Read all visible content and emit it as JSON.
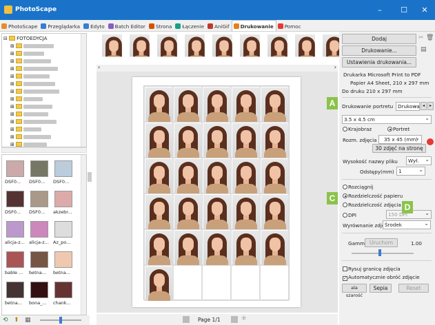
{
  "window": {
    "title": "PhotoScape",
    "minimize": "–",
    "maximize": "☐",
    "close": "✕"
  },
  "tabs": [
    {
      "label": "PhotoScape",
      "color": "#e88b2e"
    },
    {
      "label": "Przeglądarka",
      "color": "#3a7bd5"
    },
    {
      "label": "Edyto",
      "color": "#3a7bd5"
    },
    {
      "label": "Batch Editor",
      "color": "#8a5cc2"
    },
    {
      "label": "Strona",
      "color": "#d35400"
    },
    {
      "label": "Łączenie",
      "color": "#16a085"
    },
    {
      "label": "AniGif",
      "color": "#c0392b"
    },
    {
      "label": "Drukowanie",
      "color": "#e67e22",
      "active": true
    },
    {
      "label": "Pomoc",
      "color": "#e53935"
    }
  ],
  "tree": {
    "root": "FOTOEDYCJA"
  },
  "thumbnails": [
    {
      "label": "DSF0..."
    },
    {
      "label": "DSF0..."
    },
    {
      "label": "DSF0..."
    },
    {
      "label": "DSF0..."
    },
    {
      "label": "DSF0..."
    },
    {
      "label": "akzebr..."
    },
    {
      "label": "alicja-z..."
    },
    {
      "label": "alicja-z..."
    },
    {
      "label": "Az_po..."
    },
    {
      "label": "bable ..."
    },
    {
      "label": "betna..."
    },
    {
      "label": "betna..."
    },
    {
      "label": "betna..."
    },
    {
      "label": "bona_..."
    },
    {
      "label": "chank..."
    }
  ],
  "pager": {
    "text": "Page 1/1"
  },
  "right": {
    "add": "Dodaj",
    "print": "Drukowanie...",
    "print_settings": "Ustawienia drukowania...",
    "printer_label": "Drukarka",
    "printer_value": "Microsoft Print to PDF",
    "paper_label": "Papier",
    "paper_value": "A4 Sheet, 210 x 297 mm",
    "print_area_label": "Do druku",
    "print_area_value": "210 x 297 mm",
    "mode_label": "Drukowanie portretu",
    "mode_value": "Drukowa",
    "size_select": "3.5 x 4.5 cm",
    "landscape": "Krajobraz",
    "portrait": "Portret",
    "photo_size_label": "Rozm. zdjęcia",
    "photo_size_value": "35 x 45 (mm)",
    "per_page": "30 zdjęć na stronę",
    "filename_height_label": "Wysokość nazwy pliku",
    "filename_height_value": "Wył.",
    "spacing_label": "Odstępy(mm)",
    "spacing_value": "1",
    "opt_stretch": "Rozciągnij",
    "opt_paper_res": "Rozdzielczość papieru",
    "opt_photo_res": "Rozdzielczość zdjęcia",
    "opt_dpi": "DPI",
    "dpi_value": "150 DPI",
    "align_label": "Wyrównanie zdjęć",
    "align_value": "Środek",
    "gamma_label": "Gamma",
    "gamma_button": "Uruchom",
    "gamma_value": "1.00",
    "draw_border": "Rysuj granicę zdjęcia",
    "auto_rotate": "Automatycznie obróć zdjęcie",
    "btn_width": "ala szarość",
    "btn_sepia": "Sepia",
    "btn_reset": "Reset"
  },
  "badges": {
    "a": "A",
    "c": "C",
    "d": "D"
  },
  "layout_grid": {
    "cols": 5,
    "rows": 6,
    "photos": 26
  }
}
